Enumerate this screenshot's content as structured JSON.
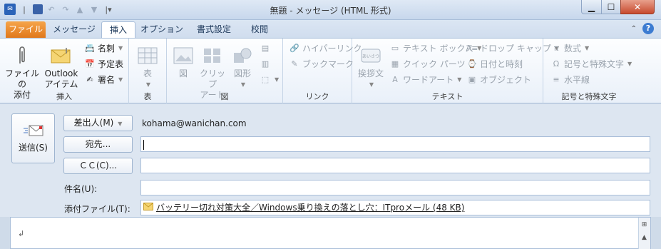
{
  "window": {
    "title": "無題 - メッセージ (HTML 形式)"
  },
  "tabs": [
    "ファイル",
    "メッセージ",
    "挿入",
    "オプション",
    "書式設定",
    "校閲"
  ],
  "ribbon": {
    "include": {
      "attach_file": "ファイルの\n添付",
      "outlook_item": "Outlook\nアイテム",
      "business_card": "名刺",
      "calendar": "予定表",
      "signature": "署名",
      "label": "挿入"
    },
    "tables": {
      "table": "表",
      "label": "表"
    },
    "illustrations": {
      "picture": "図",
      "clipart": "クリップ\nアート",
      "shapes": "図形",
      "label": "図"
    },
    "links": {
      "hyperlink": "ハイパーリンク",
      "bookmark": "ブックマーク",
      "label": "リンク"
    },
    "text": {
      "greeting": "挨拶文",
      "textbox": "テキスト ボックス",
      "quickparts": "クイック パーツ",
      "wordart": "ワードアート",
      "dropcap": "ドロップ キャップ",
      "datetime": "日付と時刻",
      "object": "オブジェクト",
      "label": "テキスト"
    },
    "symbols": {
      "equation": "数式",
      "symbol": "記号と特殊文字",
      "hline": "水平線",
      "label": "記号と特殊文字"
    }
  },
  "form": {
    "send": "送信(S)",
    "from_button": "差出人(M)",
    "from_value": "kohama@wanichan.com",
    "to_button": "宛先...",
    "cc_button": "ＣＣ(C)...",
    "subject_label": "件名(U):",
    "attach_label": "添付ファイル(T):",
    "attachment": "バッテリー切れ対策大全／Windows乗り換えの落とし穴：ITproメール (48 KB)"
  },
  "body": {
    "paragraph_mark": "↲"
  }
}
